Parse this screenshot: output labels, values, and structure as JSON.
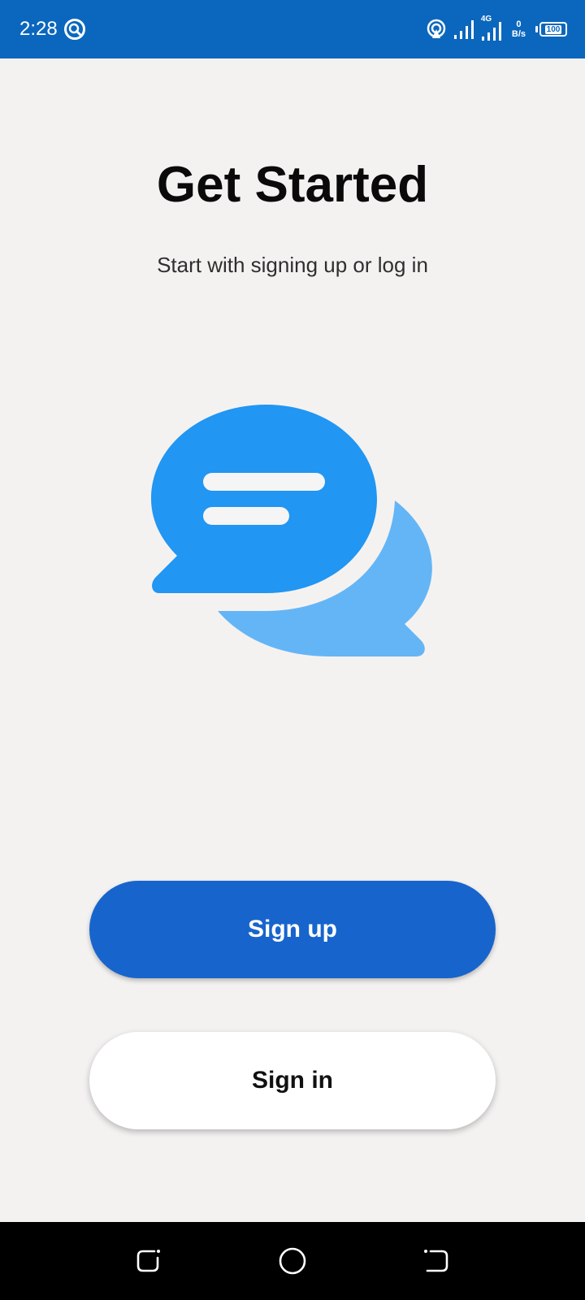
{
  "status_bar": {
    "time": "2:28",
    "network_type": "4G",
    "speed_value": "0",
    "speed_unit": "B/s",
    "battery_level": "100",
    "background_color": "#0b67bd"
  },
  "main": {
    "title": "Get Started",
    "subtitle": "Start with signing up or log in",
    "illustration_icon": "chat-bubbles-icon",
    "colors": {
      "primary_bubble": "#2196f3",
      "secondary_bubble": "#64b5f6",
      "bubble_lines": "#f5f5f5"
    }
  },
  "buttons": {
    "sign_up_label": "Sign up",
    "sign_in_label": "Sign in",
    "sign_up_color": "#1765cc",
    "sign_in_color": "#ffffff"
  },
  "nav_bar": {
    "icons": [
      "recent-apps-icon",
      "home-icon",
      "back-icon"
    ]
  }
}
